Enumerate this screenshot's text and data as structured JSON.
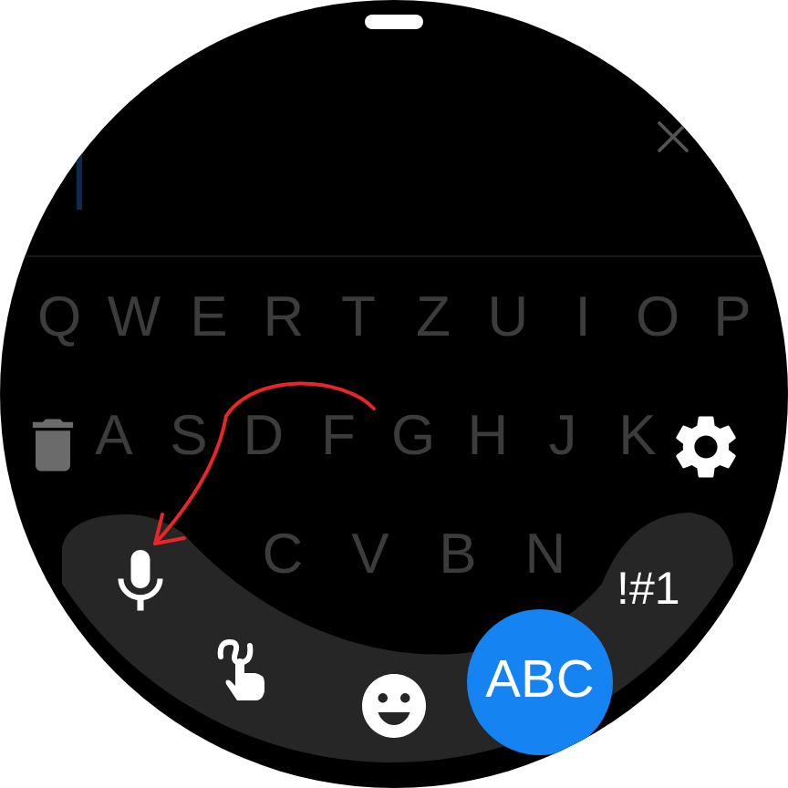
{
  "keyboard": {
    "rows": [
      [
        "Q",
        "W",
        "E",
        "R",
        "T",
        "Z",
        "U",
        "I",
        "O",
        "P"
      ],
      [
        "A",
        "S",
        "D",
        "F",
        "G",
        "H",
        "J",
        "K"
      ],
      [
        "C",
        "V",
        "B",
        "N"
      ]
    ]
  },
  "mode_keys": [
    {
      "label": "!#1",
      "selected": false
    },
    {
      "label": "ABC",
      "selected": true
    }
  ]
}
